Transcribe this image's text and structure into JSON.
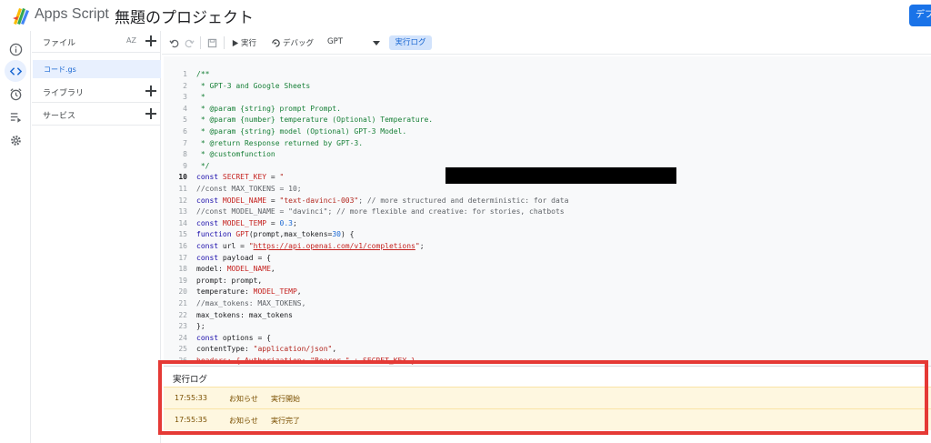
{
  "header": {
    "app_name": "Apps Script",
    "project_name": "無題のプロジェクト",
    "deploy_label": "デプロイ"
  },
  "rail": {
    "items": [
      {
        "icon": "info-icon",
        "active": false
      },
      {
        "icon": "code-icon",
        "active": true
      },
      {
        "icon": "alarm-clock-icon",
        "active": false
      },
      {
        "icon": "executions-icon",
        "active": false
      },
      {
        "icon": "gear-icon",
        "active": false
      }
    ]
  },
  "files": {
    "title": "ファイル",
    "sort_label": "AZ",
    "file_name": "コード.gs",
    "libraries_label": "ライブラリ",
    "services_label": "サービス"
  },
  "toolbar": {
    "run_label": "実行",
    "debug_label": "デバッグ",
    "function_value": "GPT",
    "log_label": "実行ログ"
  },
  "editor": {
    "current_line": 10,
    "lines": [
      [
        {
          "t": "/**",
          "c": "com"
        }
      ],
      [
        {
          "t": " * GPT-3 and Google Sheets",
          "c": "com"
        }
      ],
      [
        {
          "t": " *",
          "c": "com"
        }
      ],
      [
        {
          "t": " * @param {string} prompt Prompt.",
          "c": "com"
        }
      ],
      [
        {
          "t": " * @param {number} temperature (Optional) Temperature.",
          "c": "com"
        }
      ],
      [
        {
          "t": " * @param {string} model (Optional) GPT-3 Model.",
          "c": "com"
        }
      ],
      [
        {
          "t": " * @return Response returned by GPT-3.",
          "c": "com"
        }
      ],
      [
        {
          "t": " * @customfunction",
          "c": "com"
        }
      ],
      [
        {
          "t": " */",
          "c": "com"
        }
      ],
      [
        {
          "t": "const ",
          "c": "kw"
        },
        {
          "t": "SECRET_KEY",
          "c": "var"
        },
        {
          "t": " = ",
          "c": ""
        },
        {
          "t": "\"",
          "c": "str"
        }
      ],
      [
        {
          "t": "//const MAX_TOKENS = 10;",
          "c": "gray"
        }
      ],
      [
        {
          "t": "const ",
          "c": "kw"
        },
        {
          "t": "MODEL_NAME",
          "c": "var"
        },
        {
          "t": " = ",
          "c": ""
        },
        {
          "t": "\"text-davinci-003\"",
          "c": "str"
        },
        {
          "t": "; // more structured and deterministic: for data",
          "c": "gray"
        }
      ],
      [
        {
          "t": "//const MODEL_NAME = \"davinci\"; // more flexible and creative: for stories, chatbots",
          "c": "gray"
        }
      ],
      [
        {
          "t": "const ",
          "c": "kw"
        },
        {
          "t": "MODEL_TEMP",
          "c": "var"
        },
        {
          "t": " = ",
          "c": ""
        },
        {
          "t": "0.3",
          "c": "num"
        },
        {
          "t": ";",
          "c": ""
        }
      ],
      [
        {
          "t": "function ",
          "c": "kw"
        },
        {
          "t": "GPT",
          "c": "fn"
        },
        {
          "t": "(prompt,max_tokens=",
          "c": ""
        },
        {
          "t": "30",
          "c": "num"
        },
        {
          "t": ") {",
          "c": ""
        }
      ],
      [
        {
          "t": "const ",
          "c": "kw"
        },
        {
          "t": "url = ",
          "c": ""
        },
        {
          "t": "\"",
          "c": "str"
        },
        {
          "t": "https://api.openai.com/v1/completions",
          "c": "url"
        },
        {
          "t": "\"",
          "c": "str"
        },
        {
          "t": ";",
          "c": ""
        }
      ],
      [
        {
          "t": "const ",
          "c": "kw"
        },
        {
          "t": "payload = {",
          "c": ""
        }
      ],
      [
        {
          "t": "model: ",
          "c": ""
        },
        {
          "t": "MODEL_NAME",
          "c": "var"
        },
        {
          "t": ",",
          "c": ""
        }
      ],
      [
        {
          "t": "prompt: prompt,",
          "c": ""
        }
      ],
      [
        {
          "t": "temperature: ",
          "c": ""
        },
        {
          "t": "MODEL_TEMP",
          "c": "var"
        },
        {
          "t": ",",
          "c": ""
        }
      ],
      [
        {
          "t": "//max_tokens: MAX_TOKENS,",
          "c": "gray"
        }
      ],
      [
        {
          "t": "max_tokens: max_tokens",
          "c": ""
        }
      ],
      [
        {
          "t": "};",
          "c": ""
        }
      ],
      [
        {
          "t": "const ",
          "c": "kw"
        },
        {
          "t": "options = {",
          "c": ""
        }
      ],
      [
        {
          "t": "contentType: ",
          "c": ""
        },
        {
          "t": "\"application/json\"",
          "c": "str"
        },
        {
          "t": ",",
          "c": ""
        }
      ],
      [
        {
          "t": "headers: { Authorization: \"Bearer \" + SECRET_KEY },",
          "c": "var"
        }
      ]
    ]
  },
  "log": {
    "title": "実行ログ",
    "entries": [
      {
        "time": "17:55:33",
        "level": "お知らせ",
        "message": "実行開始"
      },
      {
        "time": "17:55:35",
        "level": "お知らせ",
        "message": "実行完了"
      }
    ]
  }
}
